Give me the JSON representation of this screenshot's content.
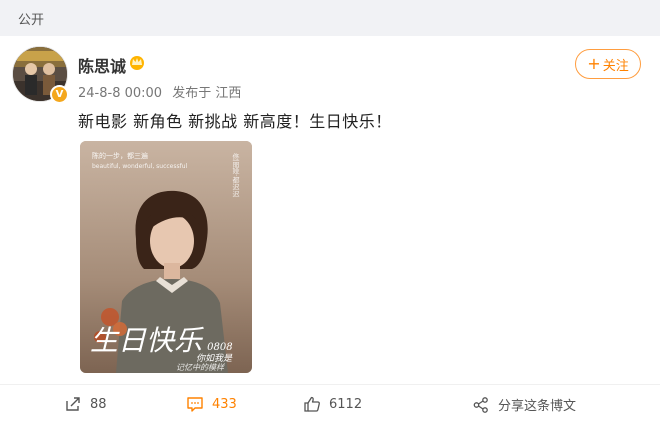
{
  "visibility": {
    "label": "公开"
  },
  "post": {
    "author": {
      "name": "陈思诚"
    },
    "meta": {
      "datetime": "24-8-8 00:00",
      "source": "发布于 江西"
    },
    "follow": {
      "label": "关注"
    },
    "text": "新电影 新角色 新挑战 新高度！生日快乐！",
    "image": {
      "top_text_1": "陈的一步，都三遍",
      "top_text_2": "beautiful, wonderful, successful",
      "vertical_text": "佟丽娅·都迟迟",
      "script_text": "生日快乐",
      "script_suffix": "0808",
      "handwriting": "你如我是",
      "handwriting_2": "记忆中的模样"
    }
  },
  "actions": {
    "repost": {
      "count": "88"
    },
    "comment": {
      "count": "433"
    },
    "like": {
      "count": "6112"
    },
    "share": {
      "label": "分享这条博文"
    }
  },
  "colors": {
    "accent": "#ff8200",
    "follow_border": "#ff9d3f",
    "background": "#f1f2f5"
  }
}
